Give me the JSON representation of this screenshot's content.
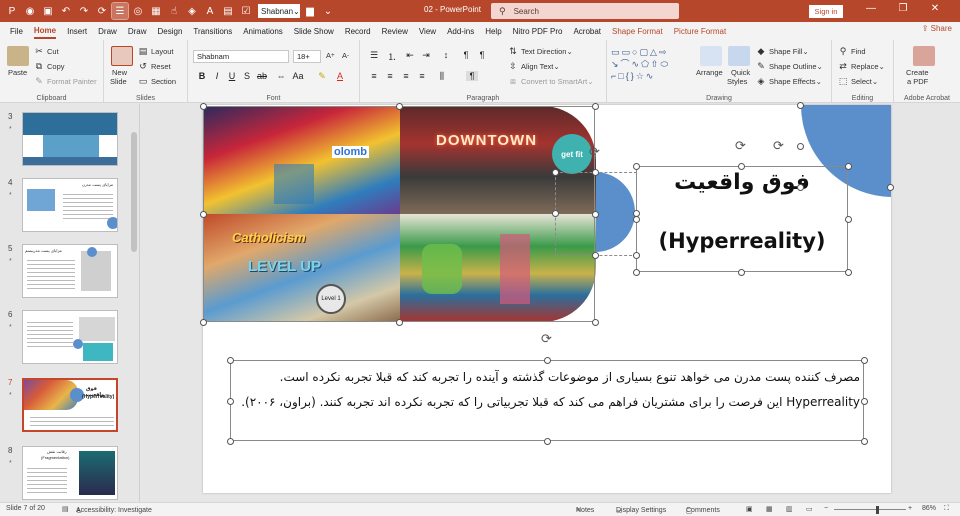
{
  "titlebar": {
    "font_value": "Shabnan",
    "doc_title": "02  -  PowerPoint",
    "search_placeholder": "Search",
    "signin": "Sign in"
  },
  "menu": {
    "tabs": [
      "File",
      "Home",
      "Insert",
      "Draw",
      "Draw",
      "Design",
      "Transitions",
      "Animations",
      "Slide Show",
      "Record",
      "Review",
      "View",
      "Add-ins",
      "Help",
      "Nitro PDF Pro",
      "Acrobat",
      "Shape Format",
      "Picture Format"
    ],
    "active": "Home",
    "share": "Share"
  },
  "ribbon": {
    "clipboard": {
      "paste": "Paste",
      "cut": "Cut",
      "copy": "Copy",
      "format_painter": "Format Painter",
      "name": "Clipboard"
    },
    "slides": {
      "new_slide": "New",
      "new_slide2": "Slide",
      "layout": "Layout",
      "reset": "Reset",
      "section": "Section",
      "name": "Slides"
    },
    "font": {
      "font_name": "Shabnam",
      "font_size": "18+",
      "name": "Font"
    },
    "paragraph": {
      "text_direction": "Text Direction",
      "align_text": "Align Text",
      "smartart": "Convert to SmartArt",
      "name": "Paragraph"
    },
    "drawing": {
      "arrange": "Arrange",
      "quick_styles": "Quick",
      "quick_styles2": "Styles",
      "shape_fill": "Shape Fill",
      "shape_outline": "Shape Outline",
      "shape_effects": "Shape Effects",
      "name": "Drawing"
    },
    "editing": {
      "find": "Find",
      "replace": "Replace",
      "select": "Select",
      "name": "Editing"
    },
    "acrobat": {
      "create_pdf": "Create",
      "create_pdf2": "a PDF",
      "name": "Adobe Acrobat"
    }
  },
  "thumbnails": [
    {
      "num": "3",
      "star": "*"
    },
    {
      "num": "4",
      "star": "*"
    },
    {
      "num": "5",
      "star": "*"
    },
    {
      "num": "6",
      "star": "*"
    },
    {
      "num": "7",
      "star": "*"
    },
    {
      "num": "8",
      "star": "*"
    }
  ],
  "thumb_texts": {
    "t4": "مزایای پست مدرن",
    "t5": "مزایای پست مدرنیسم",
    "t7a": "فوق واقعیت",
    "t7b": "(Hyperreality)",
    "t8a": "رقابت نقش",
    "t8b": "(Fragmentation)"
  },
  "slide": {
    "title_fa": "فوق واقعیت",
    "title_en": "(Hyperreality)",
    "body": "مصرف کننده پست مدرن می خواهد تنوع بسیاری از موضوعات گذشته و آینده را تجربه کند که قبلا تجربه نکرده است. Hyperreality این فرصت را برای مشتریان فراهم می کند که قبلا تجربیاتی را که تجربه نکرده اند تجربه کنند. (براون، ۲۰۰۶).",
    "collage_text": {
      "downtown": "DOWNTOWN",
      "get_fit": "get fit",
      "catholicism": "Catholicism",
      "level_up": "LEVEL UP",
      "colombo": "olomb",
      "level": "Level 1"
    }
  },
  "status": {
    "slide_of": "Slide 7 of 20",
    "accessibility": "Accessibility: Investigate",
    "notes": "Notes",
    "display_settings": "Display Settings",
    "comments": "Comments",
    "zoom": "86%"
  },
  "colors": {
    "accent": "#b7472a",
    "shape_blue": "#5b8fcb",
    "thumb_highlight": "#c4472b"
  }
}
